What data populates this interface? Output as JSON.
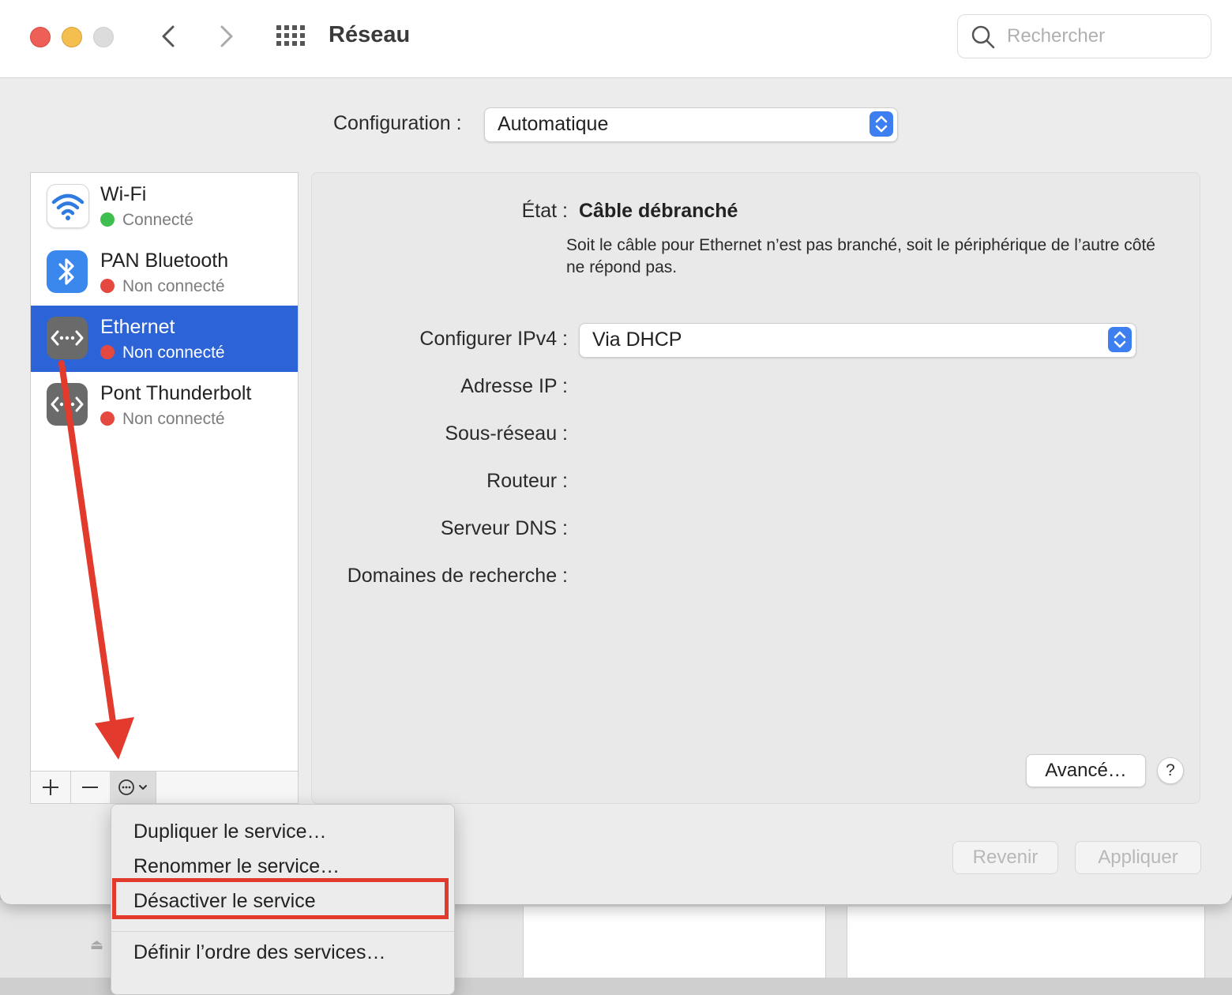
{
  "window": {
    "title": "Réseau"
  },
  "search": {
    "placeholder": "Rechercher"
  },
  "configuration": {
    "label": "Configuration :",
    "value": "Automatique"
  },
  "services": [
    {
      "name": "Wi-Fi",
      "status": "Connecté",
      "status_color": "#3fbf4f",
      "icon": "wifi-icon",
      "selected": false
    },
    {
      "name": "PAN Bluetooth",
      "status": "Non connecté",
      "status_color": "#e5483f",
      "icon": "bluetooth-icon",
      "selected": false
    },
    {
      "name": "Ethernet",
      "status": "Non connecté",
      "status_color": "#e5483f",
      "icon": "ethernet-icon",
      "selected": true
    },
    {
      "name": "Pont Thunderbolt",
      "status": "Non connecté",
      "status_color": "#e5483f",
      "icon": "ethernet-icon",
      "selected": false
    }
  ],
  "detail": {
    "state_label": "État :",
    "state_value": "Câble débranché",
    "state_description": "Soit le câble pour Ethernet n’est pas branché, soit le périphérique de l’autre côté ne répond pas.",
    "ipv4_label": "Configurer IPv4 :",
    "ipv4_value": "Via DHCP",
    "ip_label": "Adresse IP :",
    "subnet_label": "Sous-réseau :",
    "router_label": "Routeur :",
    "dns_label": "Serveur DNS :",
    "search_domains_label": "Domaines de recherche :",
    "advanced_label": "Avancé…",
    "help_label": "?"
  },
  "footer": {
    "revert_label": "Revenir",
    "apply_label": "Appliquer"
  },
  "action_menu": {
    "items": [
      "Dupliquer le service…",
      "Renommer le service…",
      "Désactiver le service",
      "Définir l’ordre des services…"
    ],
    "highlighted": "Désactiver le service"
  },
  "colors": {
    "accent": "#2c63d7",
    "annotation": "#e23a2c"
  }
}
